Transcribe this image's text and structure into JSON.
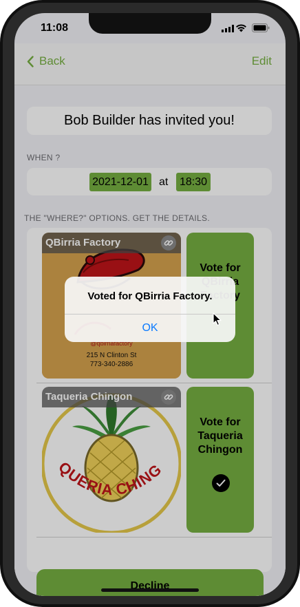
{
  "status_bar": {
    "time": "11:08"
  },
  "nav": {
    "back_label": "Back",
    "edit_label": "Edit"
  },
  "invite": {
    "title": "Bob Builder has invited you!"
  },
  "when": {
    "label": "WHEN ?",
    "date": "2021-12-01",
    "at": "at",
    "time": "18:30"
  },
  "where": {
    "label": "THE \"WHERE?\" OPTIONS. GET THE DETAILS."
  },
  "options": [
    {
      "name": "QBirria Factory",
      "vote_label": "Vote for QBirria Factory",
      "logo_handle": "@qbirriafactory",
      "logo_address": "215 N Clinton St",
      "logo_phone": "773-340-2886",
      "voted": false
    },
    {
      "name": "Taqueria Chingon",
      "vote_label": "Vote for Taqueria Chingon",
      "logo_text": "TAQUERIA CHINGÓN",
      "voted": true
    }
  ],
  "decline": {
    "label": "Decline"
  },
  "alert": {
    "title": "Voted for QBirria Factory.",
    "ok_label": "OK"
  },
  "colors": {
    "accent": "#76b041",
    "alert_button": "#0a7aff"
  },
  "icons": {
    "back": "chevron-left-icon",
    "link": "link-icon",
    "check": "checkmark-circle-icon"
  }
}
